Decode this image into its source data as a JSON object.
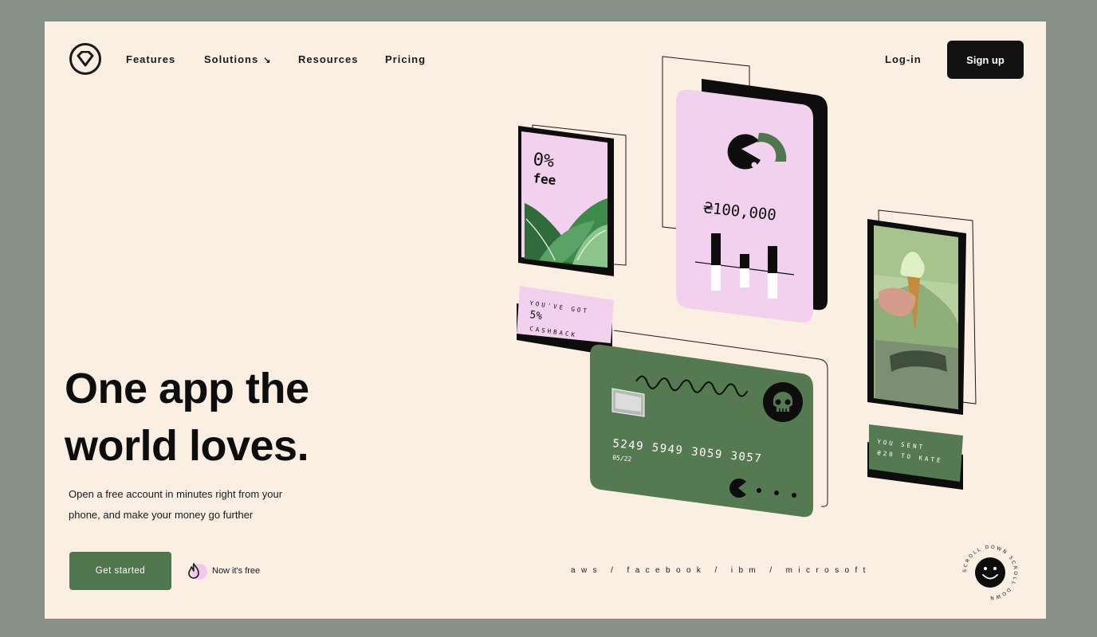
{
  "nav": {
    "items": [
      {
        "label": "Features"
      },
      {
        "label": "Solutions",
        "arrow": "↘"
      },
      {
        "label": "Resources"
      },
      {
        "label": "Pricing"
      }
    ],
    "login_label": "Log-in",
    "signup_label": "Sign up"
  },
  "hero": {
    "title_line1": "One app the",
    "title_line2": "world loves.",
    "subtitle_line1": "Open a free account in minutes right from your",
    "subtitle_line2": "phone, and make your money go further",
    "cta_label": "Get started",
    "free_note": "Now it's free"
  },
  "cards": {
    "fee_line1": "0%",
    "fee_line2": "fee",
    "balance": "₴100,000",
    "cashback_line1": "YOU'VE GOT",
    "cashback_line2": "5%",
    "cashback_line3": "CASHBACK",
    "card_number": "5249 5949 3059 3057",
    "card_expiry": "05/22",
    "sent_line1": "YOU SENT",
    "sent_line2": "₴20 TO KATE"
  },
  "brands": "aws / facebook / ibm / microsoft",
  "scroll_text": "SCROLL DOWN SCROLL DOWN",
  "colors": {
    "background": "#879187",
    "page": "#fbeee3",
    "green": "#4f764c",
    "pink": "#f2d1ee",
    "dark": "#121212"
  },
  "icons": [
    "logo-diamond-icon",
    "flame-icon",
    "pacman-icon",
    "skull-icon",
    "smiley-icon",
    "chip-icon"
  ]
}
